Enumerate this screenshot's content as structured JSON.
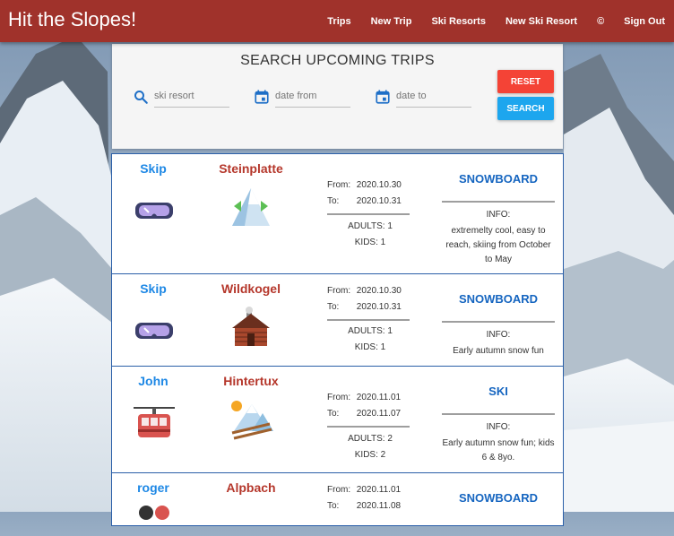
{
  "header": {
    "title": "Hit the Slopes!",
    "nav": [
      "Trips",
      "New Trip",
      "Ski Resorts",
      "New Ski Resort",
      "©",
      "Sign Out"
    ]
  },
  "search": {
    "title": "SEARCH UPCOMING TRIPS",
    "resort_placeholder": "ski resort",
    "date_from_placeholder": "date from",
    "date_to_placeholder": "date to",
    "reset_label": "RESET",
    "search_label": "SEARCH"
  },
  "labels": {
    "from": "From:",
    "to": "To:",
    "info": "INFO:"
  },
  "trips": [
    {
      "user": "Skip",
      "resort": "Steinplatte",
      "from": "2020.10.30",
      "to": "2020.10.31",
      "adults": "ADULTS: 1",
      "kids": "KIDS: 1",
      "sport": "SNOWBOARD",
      "info": "extremelty cool, easy to reach, skiing from October to May",
      "icon1": "ski-goggles-icon",
      "icon2": "mountain-icon"
    },
    {
      "user": "Skip",
      "resort": "Wildkogel",
      "from": "2020.10.30",
      "to": "2020.10.31",
      "adults": "ADULTS: 1",
      "kids": "KIDS: 1",
      "sport": "SNOWBOARD",
      "info": "Early autumn snow fun",
      "icon1": "ski-goggles-icon",
      "icon2": "cabin-icon"
    },
    {
      "user": "John",
      "resort": "Hintertux",
      "from": "2020.11.01",
      "to": "2020.11.07",
      "adults": "ADULTS: 2",
      "kids": "KIDS: 2",
      "sport": "SKI",
      "info": "Early autumn snow fun; kids 6 & 8yo.",
      "icon1": "cable-car-icon",
      "icon2": "mountain-skis-icon"
    },
    {
      "user": "roger",
      "resort": "Alpbach",
      "from": "2020.11.01",
      "to": "2020.11.08",
      "adults": "",
      "kids": "",
      "sport": "SNOWBOARD",
      "info": "",
      "icon1": "ski-goggles-icon",
      "icon2": ""
    }
  ],
  "colors": {
    "header": "#a0322b",
    "reset": "#f44336",
    "search": "#1da6ee",
    "name": "#1e88e5",
    "resort": "#b5372b",
    "sport": "#1565c0"
  }
}
